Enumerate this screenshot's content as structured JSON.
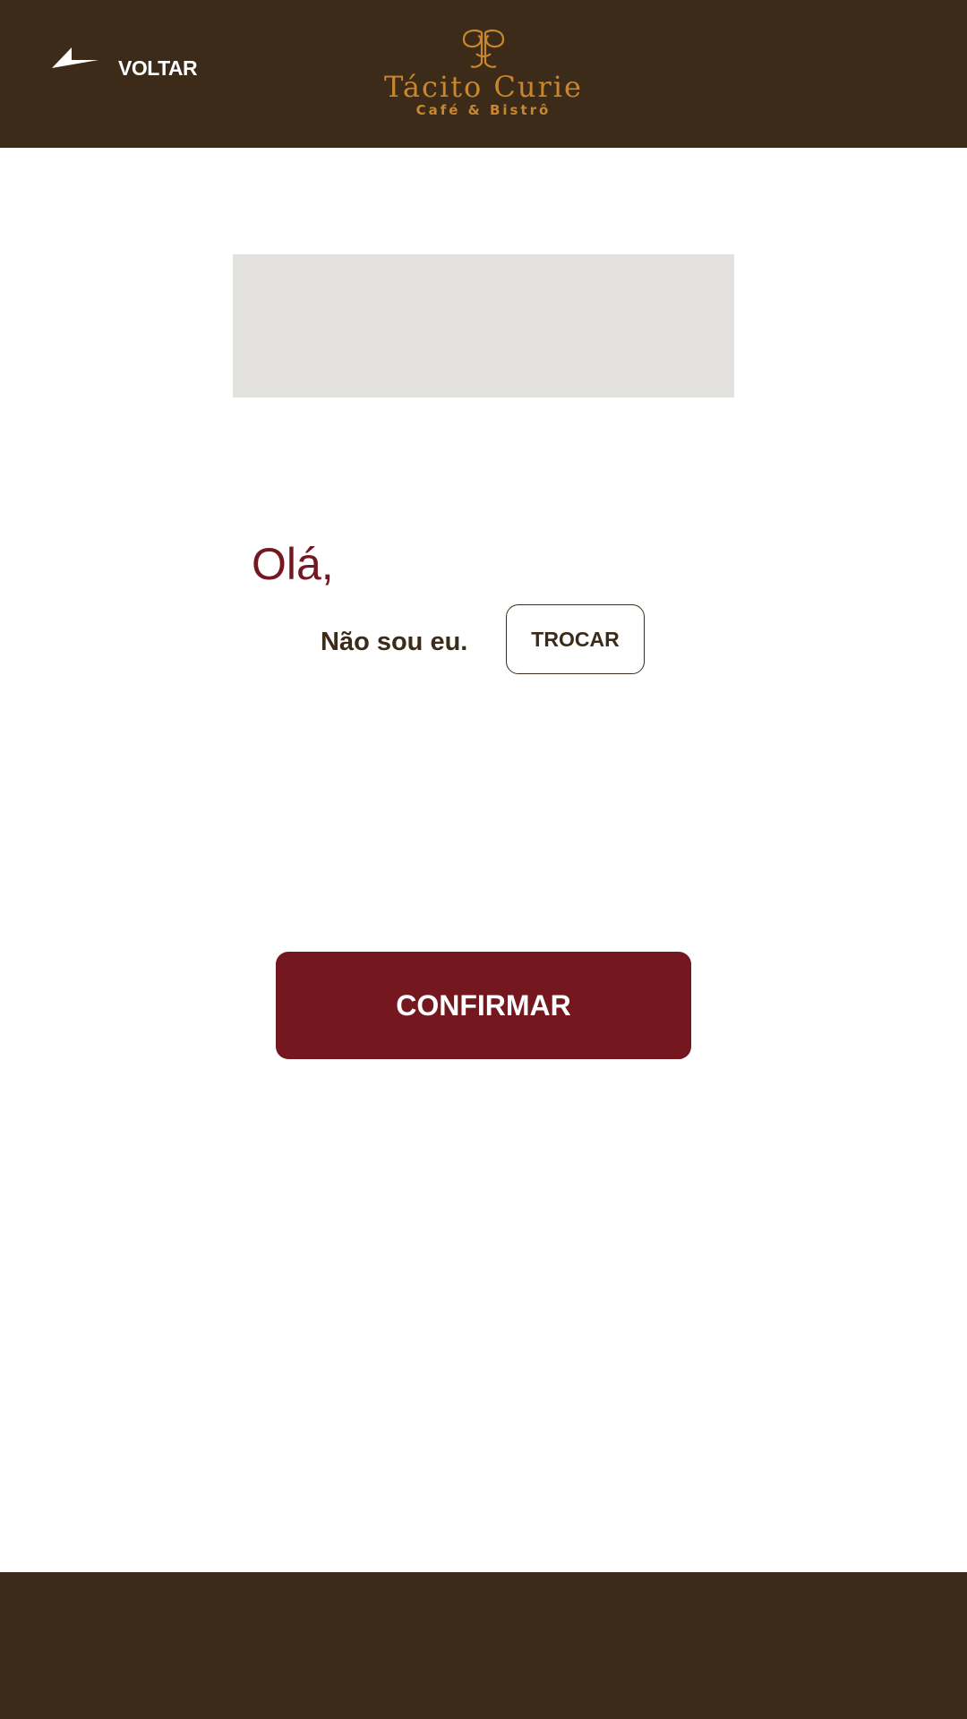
{
  "header": {
    "back_label": "VOLTAR",
    "brand_name": "Tácito Curie",
    "brand_tagline": "Café & Bistrô",
    "back_icon": "arrow-left-icon",
    "logo_icon": "logo-monogram-icon"
  },
  "main": {
    "greeting": "Olá,",
    "not_me_text": "Não sou eu.",
    "swap_button": "TROCAR",
    "confirm_button": "CONFIRMAR"
  },
  "colors": {
    "header_bg": "#3d2b19",
    "brand_gold": "#c8872f",
    "accent_wine": "#74171f",
    "banner_gray": "#e3e1de"
  }
}
